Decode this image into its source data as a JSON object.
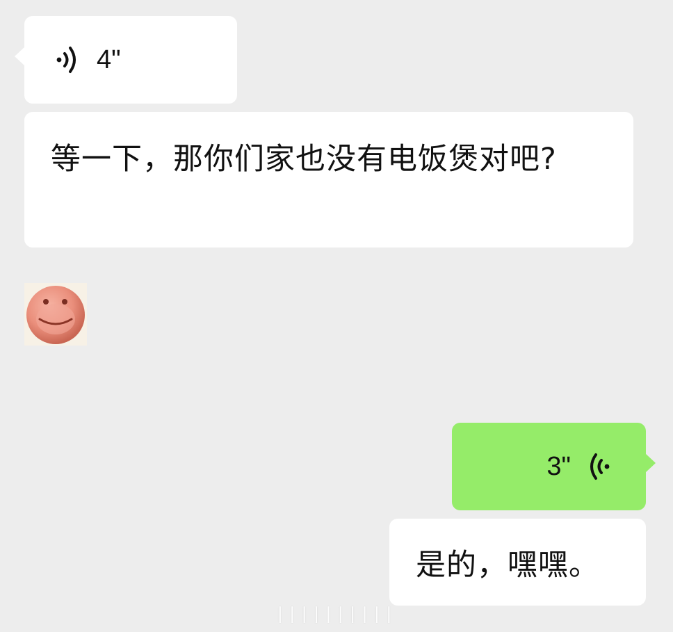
{
  "conversation": {
    "messages": [
      {
        "type": "voice",
        "side": "incoming",
        "duration": "4\"",
        "icon": "voice-wave-icon"
      },
      {
        "type": "text",
        "side": "incoming",
        "text": "等一下，那你们家也没有电饭煲对吧?"
      },
      {
        "type": "sticker",
        "side": "incoming",
        "icon": "smiley-face-sticker"
      },
      {
        "type": "voice",
        "side": "outgoing",
        "duration": "3\"",
        "icon": "voice-wave-icon"
      },
      {
        "type": "text",
        "side": "outgoing",
        "text": "是的，嘿嘿。"
      }
    ]
  },
  "colors": {
    "background": "#ededed",
    "incoming_bubble": "#ffffff",
    "outgoing_bubble": "#95ec69"
  }
}
